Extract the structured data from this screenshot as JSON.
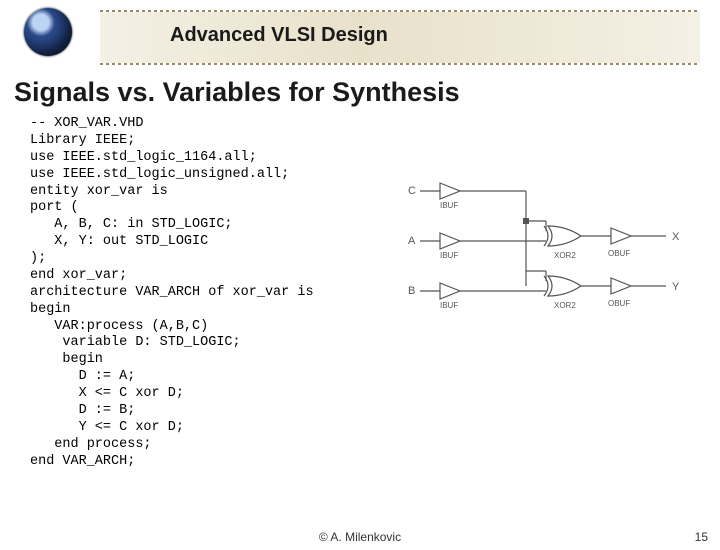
{
  "header": {
    "course_title": "Advanced VLSI Design"
  },
  "slide": {
    "title": "Signals vs. Variables for Synthesis"
  },
  "code": {
    "lines": [
      "-- XOR_VAR.VHD",
      "Library IEEE;",
      "use IEEE.std_logic_1164.all;",
      "use IEEE.std_logic_unsigned.all;",
      "entity xor_var is",
      "port (",
      "   A, B, C: in STD_LOGIC;",
      "   X, Y: out STD_LOGIC",
      ");",
      "end xor_var;",
      "architecture VAR_ARCH of xor_var is",
      "begin",
      "   VAR:process (A,B,C)",
      "    variable D: STD_LOGIC;",
      "    begin",
      "      D := A;",
      "      X <= C xor D;",
      "      D := B;",
      "      Y <= C xor D;",
      "   end process;",
      "end VAR_ARCH;"
    ]
  },
  "schematic": {
    "inputs": [
      "C",
      "A",
      "B"
    ],
    "outputs": [
      "X",
      "Y"
    ],
    "buffers": [
      "IBUF",
      "IBUF",
      "IBUF",
      "OBUF",
      "OBUF"
    ],
    "gates": [
      "XOR2",
      "XOR2"
    ]
  },
  "footer": {
    "copyright": "© A. Milenkovic",
    "page": "15"
  }
}
